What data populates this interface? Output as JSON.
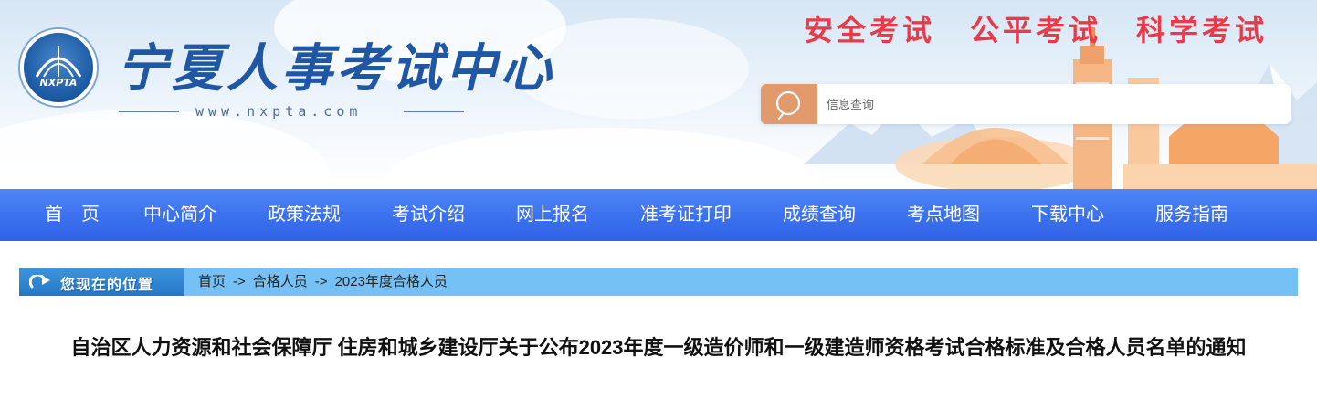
{
  "header": {
    "logo_text": "宁夏人事考试中心",
    "logo_url": "www.nxpta.com",
    "emblem_text": "NXPTA",
    "slogans": [
      "安全考试",
      "公平考试",
      "科学考试"
    ],
    "search": {
      "placeholder": "信息查询",
      "icon": "search-icon"
    },
    "colors": {
      "slogan": "#e83b4a",
      "logo": "#1f57a4",
      "search_button": "#e29a6c"
    }
  },
  "nav": {
    "items": [
      "首　页",
      "中心简介",
      "政策法规",
      "考试介绍",
      "网上报名",
      "准考证打印",
      "成绩查询",
      "考点地图",
      "下载中心",
      "服务指南"
    ],
    "colors": {
      "bar": "#3b70ee",
      "text": "#ffffff"
    }
  },
  "breadcrumb": {
    "label": "您现在的位置",
    "items": [
      "首页",
      "合格人员",
      "2023年度合格人员"
    ],
    "separator": "->"
  },
  "article": {
    "title": "自治区人力资源和社会保障厅 住房和城乡建设厅关于公布2023年度一级造价师和一级建造师资格考试合格标准及合格人员名单的通知"
  }
}
